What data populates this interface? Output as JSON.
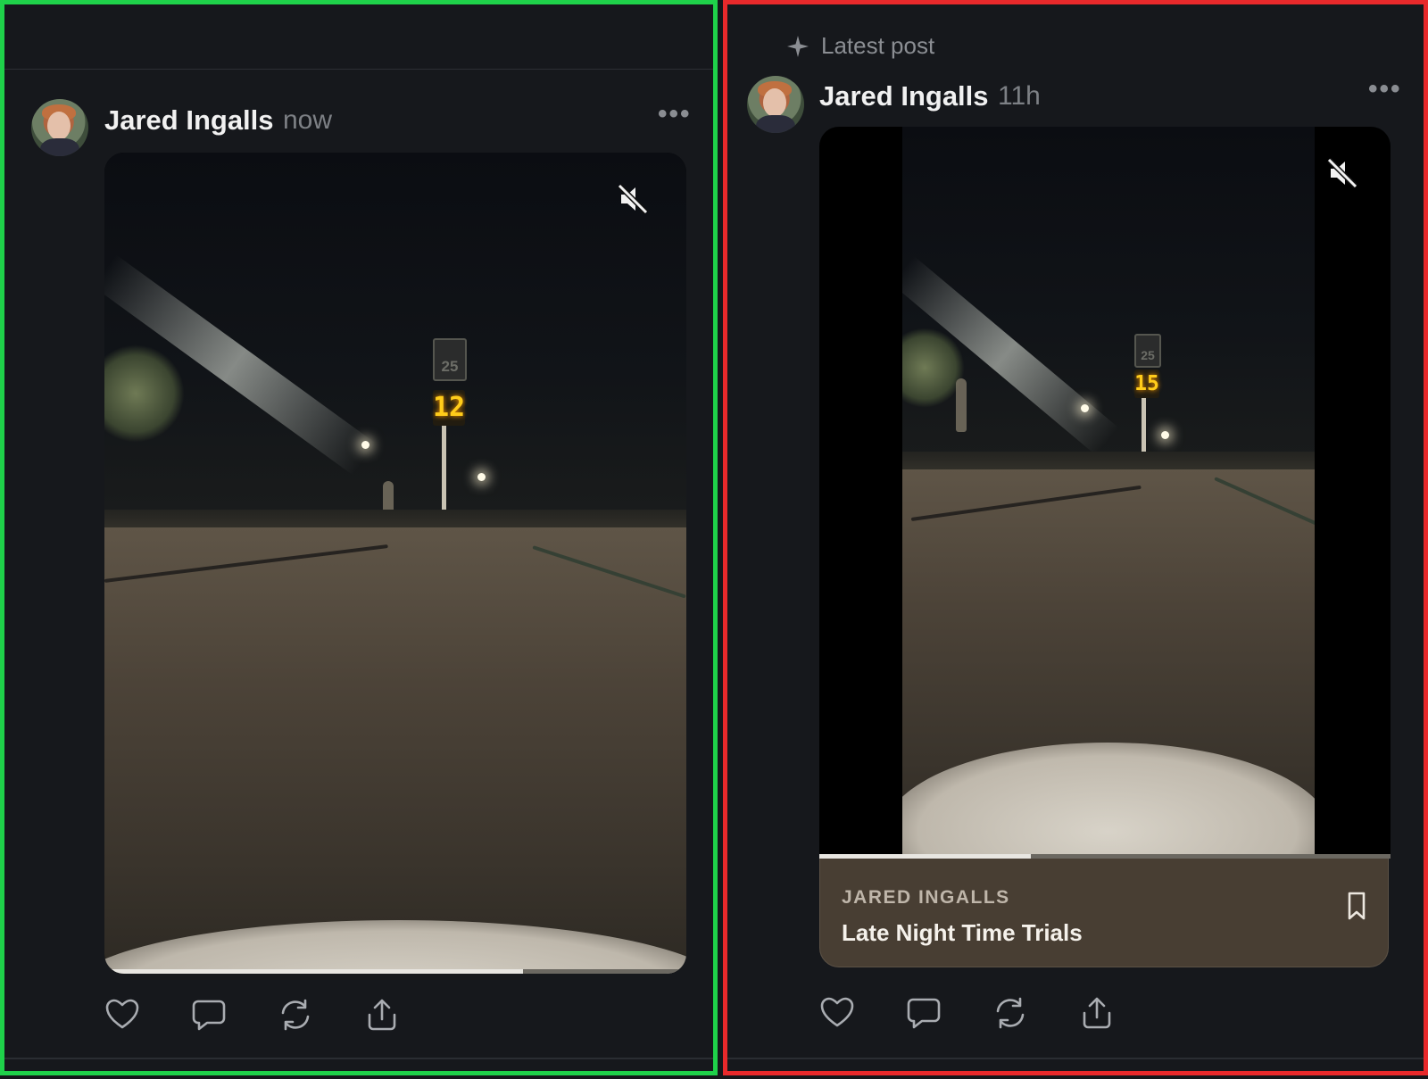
{
  "left_post": {
    "author": "Jared Ingalls",
    "time": "now",
    "more_label": "•••",
    "video": {
      "progress": 0.72,
      "speed_sign_limit": "25",
      "speed_display": "12",
      "muted": true
    },
    "actions": [
      "heart-icon",
      "comment-icon",
      "repost-icon",
      "share-icon"
    ]
  },
  "right_post": {
    "banner": "Latest post",
    "author": "Jared Ingalls",
    "time": "11h",
    "more_label": "•••",
    "video": {
      "progress": 0.37,
      "speed_sign_limit": "25",
      "speed_display": "15",
      "muted": true
    },
    "caption": {
      "author": "JARED INGALLS",
      "title": "Late Night Time Trials"
    },
    "actions": [
      "heart-icon",
      "comment-icon",
      "repost-icon",
      "share-icon"
    ]
  },
  "colors": {
    "background": "#16181c",
    "left_border": "#1fd14a",
    "right_border": "#e8292b",
    "speed_digits": "#ffcc1a",
    "caption_bg": "#483e33"
  }
}
